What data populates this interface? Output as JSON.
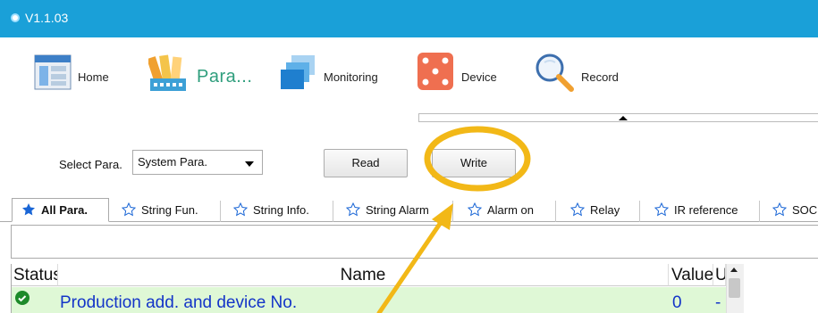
{
  "window": {
    "version": "V1.1.03"
  },
  "toolbar": {
    "items": [
      {
        "label": "Home",
        "icon": "home-icon"
      },
      {
        "label": "Para...",
        "icon": "parameter-icon"
      },
      {
        "label": "Monitoring",
        "icon": "monitoring-icon"
      },
      {
        "label": "Device",
        "icon": "device-icon"
      },
      {
        "label": "Record",
        "icon": "record-icon"
      }
    ]
  },
  "controls": {
    "select_label": "Select Para.",
    "select_value": "System Para.",
    "read_label": "Read",
    "write_label": "Write"
  },
  "tabs": [
    {
      "label": "All Para.",
      "active": true
    },
    {
      "label": "String Fun."
    },
    {
      "label": "String Info."
    },
    {
      "label": "String Alarm"
    },
    {
      "label": "Alarm on"
    },
    {
      "label": "Relay"
    },
    {
      "label": "IR reference"
    },
    {
      "label": "SOC"
    }
  ],
  "table": {
    "columns": [
      "Status",
      "Name",
      "Value",
      "Unit"
    ],
    "rows": [
      {
        "status": "ok",
        "name": "Production add. and device No.",
        "value": "0",
        "unit": "-"
      }
    ]
  },
  "colors": {
    "titlebar": "#1aa0d8",
    "row_bg": "#dff8d6",
    "highlight": "#f2b817",
    "value_text": "#1334c8"
  }
}
